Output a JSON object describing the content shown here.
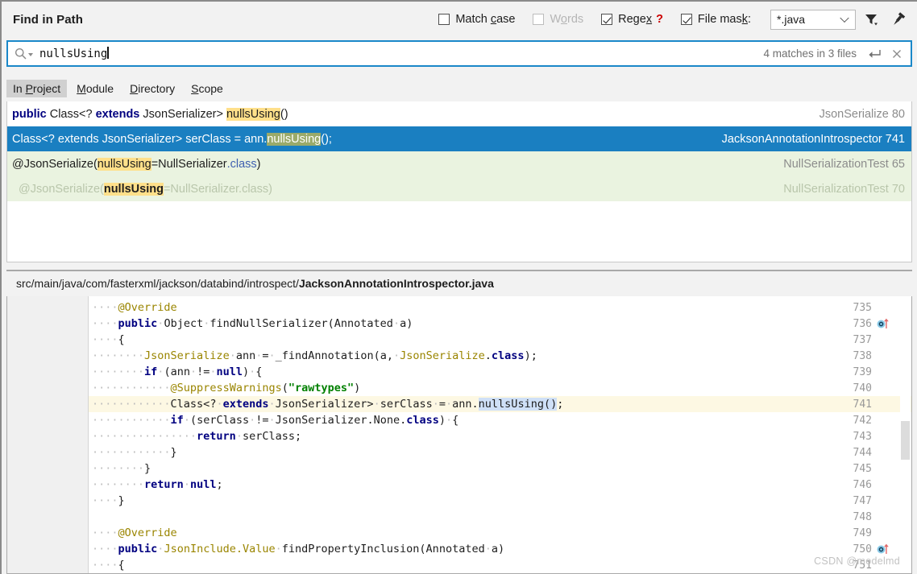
{
  "window": {
    "title": "Find in Path"
  },
  "options": {
    "match_case": {
      "label_pre": "Match ",
      "label_accel": "c",
      "label_post": "ase",
      "checked": false,
      "enabled": true
    },
    "words": {
      "label_pre": "W",
      "label_accel": "o",
      "label_post": "rds",
      "checked": false,
      "enabled": false
    },
    "regex": {
      "label_pre": "Rege",
      "label_accel": "x",
      "label_post": "",
      "checked": true,
      "enabled": true,
      "help": "?"
    },
    "file_mask": {
      "label_pre": "File mas",
      "label_accel": "k",
      "label_post": ":",
      "checked": true,
      "enabled": true,
      "value": "*.java"
    },
    "filter_icon": "filter-icon",
    "pin_icon": "pin-icon"
  },
  "search": {
    "icon": "search-icon",
    "query": "nullsUsing",
    "placeholder": "",
    "match_count": "4 matches in 3 files",
    "enter_icon": "enter-icon",
    "close_icon": "close-icon"
  },
  "scopes": {
    "items": [
      {
        "pre": "In ",
        "accel": "P",
        "post": "roject",
        "active": true
      },
      {
        "pre": "",
        "accel": "M",
        "post": "odule",
        "active": false
      },
      {
        "pre": "",
        "accel": "D",
        "post": "irectory",
        "active": false
      },
      {
        "pre": "",
        "accel": "S",
        "post": "cope",
        "active": false
      }
    ]
  },
  "results": [
    {
      "state": "normal",
      "segments": [
        {
          "text": "public ",
          "style": "kw"
        },
        {
          "text": "Class<? ",
          "style": "plain"
        },
        {
          "text": "extends ",
          "style": "kw"
        },
        {
          "text": "JsonSerializer> ",
          "style": "plain"
        },
        {
          "text": "nullsUsing",
          "style": "hl"
        },
        {
          "text": "()",
          "style": "plain"
        }
      ],
      "file": "JsonSerialize",
      "line": "80"
    },
    {
      "state": "selected",
      "segments": [
        {
          "text": "Class<? extends JsonSerializer> serClass = ann.",
          "style": "plain"
        },
        {
          "text": "nullsUsing",
          "style": "hl"
        },
        {
          "text": "();",
          "style": "plain"
        }
      ],
      "file": "JacksonAnnotationIntrospector",
      "line": "741"
    },
    {
      "state": "green",
      "segments": [
        {
          "text": "@JsonSerialize(",
          "style": "plain"
        },
        {
          "text": "nullsUsing",
          "style": "hl"
        },
        {
          "text": "=NullSerializer",
          "style": "plain"
        },
        {
          "text": ".class",
          "style": "blue"
        },
        {
          "text": ")",
          "style": "plain"
        }
      ],
      "file": "NullSerializationTest",
      "line": "65"
    },
    {
      "state": "faded",
      "segments": [
        {
          "text": "  @JsonSerialize(",
          "style": "plain"
        },
        {
          "text": "nullsUsing",
          "style": "hl"
        },
        {
          "text": "=NullSerializer.class)",
          "style": "plain"
        }
      ],
      "file": "NullSerializationTest",
      "line": "70"
    }
  ],
  "preview": {
    "path_prefix": "src/main/java/com/fasterxml/jackson/databind/introspect/",
    "path_file": "JacksonAnnotationIntrospector.java",
    "highlight_line": 741,
    "code": [
      {
        "num": "735",
        "marker": null,
        "segments": [
          {
            "text": "····",
            "style": "dot"
          },
          {
            "text": "@Override",
            "style": "ann"
          }
        ]
      },
      {
        "num": "736",
        "marker": "override-icon",
        "segments": [
          {
            "text": "····",
            "style": "dot"
          },
          {
            "text": "public",
            "style": "kw"
          },
          {
            "text": "·",
            "style": "dot"
          },
          {
            "text": "Object",
            "style": "plain"
          },
          {
            "text": "·",
            "style": "dot"
          },
          {
            "text": "findNullSerializer(Annotated",
            "style": "plain"
          },
          {
            "text": "·",
            "style": "dot"
          },
          {
            "text": "a)",
            "style": "plain"
          }
        ]
      },
      {
        "num": "737",
        "marker": null,
        "segments": [
          {
            "text": "····",
            "style": "dot"
          },
          {
            "text": "{",
            "style": "plain"
          }
        ]
      },
      {
        "num": "738",
        "marker": null,
        "segments": [
          {
            "text": "········",
            "style": "dot"
          },
          {
            "text": "JsonSerialize",
            "style": "type"
          },
          {
            "text": "·",
            "style": "dot"
          },
          {
            "text": "ann",
            "style": "plain"
          },
          {
            "text": "·",
            "style": "dot"
          },
          {
            "text": "=",
            "style": "plain"
          },
          {
            "text": "·",
            "style": "dot"
          },
          {
            "text": "_findAnnotation(a,",
            "style": "plain"
          },
          {
            "text": "·",
            "style": "dot"
          },
          {
            "text": "JsonSerialize",
            "style": "type"
          },
          {
            "text": ".",
            "style": "plain"
          },
          {
            "text": "class",
            "style": "kw"
          },
          {
            "text": ");",
            "style": "plain"
          }
        ]
      },
      {
        "num": "739",
        "marker": null,
        "segments": [
          {
            "text": "········",
            "style": "dot"
          },
          {
            "text": "if",
            "style": "kw"
          },
          {
            "text": "·",
            "style": "dot"
          },
          {
            "text": "(ann",
            "style": "plain"
          },
          {
            "text": "·",
            "style": "dot"
          },
          {
            "text": "!=",
            "style": "plain"
          },
          {
            "text": "·",
            "style": "dot"
          },
          {
            "text": "null",
            "style": "kw"
          },
          {
            "text": ")",
            "style": "plain"
          },
          {
            "text": "·",
            "style": "dot"
          },
          {
            "text": "{",
            "style": "plain"
          }
        ]
      },
      {
        "num": "740",
        "marker": null,
        "segments": [
          {
            "text": "············",
            "style": "dot"
          },
          {
            "text": "@SuppressWarnings",
            "style": "ann"
          },
          {
            "text": "(",
            "style": "plain"
          },
          {
            "text": "\"rawtypes\"",
            "style": "str"
          },
          {
            "text": ")",
            "style": "plain"
          }
        ]
      },
      {
        "num": "741",
        "marker": null,
        "segments": [
          {
            "text": "············",
            "style": "dot"
          },
          {
            "text": "Class<?",
            "style": "plain"
          },
          {
            "text": "·",
            "style": "dot"
          },
          {
            "text": "extends",
            "style": "kw"
          },
          {
            "text": "·",
            "style": "dot"
          },
          {
            "text": "JsonSerializer>",
            "style": "plain"
          },
          {
            "text": "·",
            "style": "dot"
          },
          {
            "text": "serClass",
            "style": "plain"
          },
          {
            "text": "·",
            "style": "dot"
          },
          {
            "text": "=",
            "style": "plain"
          },
          {
            "text": "·",
            "style": "dot"
          },
          {
            "text": "ann.",
            "style": "plain"
          },
          {
            "text": "nullsUsing()",
            "style": "sel"
          },
          {
            "text": ";",
            "style": "plain"
          }
        ]
      },
      {
        "num": "742",
        "marker": null,
        "segments": [
          {
            "text": "············",
            "style": "dot"
          },
          {
            "text": "if",
            "style": "kw"
          },
          {
            "text": "·",
            "style": "dot"
          },
          {
            "text": "(serClass",
            "style": "plain"
          },
          {
            "text": "·",
            "style": "dot"
          },
          {
            "text": "!=",
            "style": "plain"
          },
          {
            "text": "·",
            "style": "dot"
          },
          {
            "text": "JsonSerializer.None.",
            "style": "plain"
          },
          {
            "text": "class",
            "style": "kw"
          },
          {
            "text": ")",
            "style": "plain"
          },
          {
            "text": "·",
            "style": "dot"
          },
          {
            "text": "{",
            "style": "plain"
          }
        ]
      },
      {
        "num": "743",
        "marker": null,
        "segments": [
          {
            "text": "················",
            "style": "dot"
          },
          {
            "text": "return",
            "style": "kw"
          },
          {
            "text": "·",
            "style": "dot"
          },
          {
            "text": "serClass;",
            "style": "plain"
          }
        ]
      },
      {
        "num": "744",
        "marker": null,
        "segments": [
          {
            "text": "············",
            "style": "dot"
          },
          {
            "text": "}",
            "style": "plain"
          }
        ]
      },
      {
        "num": "745",
        "marker": null,
        "segments": [
          {
            "text": "········",
            "style": "dot"
          },
          {
            "text": "}",
            "style": "plain"
          }
        ]
      },
      {
        "num": "746",
        "marker": null,
        "segments": [
          {
            "text": "········",
            "style": "dot"
          },
          {
            "text": "return",
            "style": "kw"
          },
          {
            "text": "·",
            "style": "dot"
          },
          {
            "text": "null",
            "style": "kw"
          },
          {
            "text": ";",
            "style": "plain"
          }
        ]
      },
      {
        "num": "747",
        "marker": null,
        "segments": [
          {
            "text": "····",
            "style": "dot"
          },
          {
            "text": "}",
            "style": "plain"
          }
        ]
      },
      {
        "num": "748",
        "marker": null,
        "segments": []
      },
      {
        "num": "749",
        "marker": null,
        "segments": [
          {
            "text": "····",
            "style": "dot"
          },
          {
            "text": "@Override",
            "style": "ann"
          }
        ]
      },
      {
        "num": "750",
        "marker": "override-icon",
        "segments": [
          {
            "text": "····",
            "style": "dot"
          },
          {
            "text": "public",
            "style": "kw"
          },
          {
            "text": "·",
            "style": "dot"
          },
          {
            "text": "JsonInclude.Value",
            "style": "type"
          },
          {
            "text": "·",
            "style": "dot"
          },
          {
            "text": "findPropertyInclusion(Annotated",
            "style": "plain"
          },
          {
            "text": "·",
            "style": "dot"
          },
          {
            "text": "a)",
            "style": "plain"
          }
        ]
      },
      {
        "num": "751",
        "marker": null,
        "segments": [
          {
            "text": "····",
            "style": "dot"
          },
          {
            "text": "{",
            "style": "plain"
          }
        ]
      }
    ]
  },
  "watermark": {
    "text": "CSDN @modelmd"
  }
}
